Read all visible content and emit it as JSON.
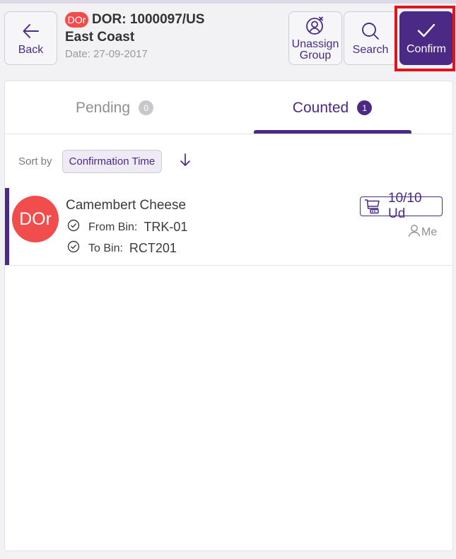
{
  "header": {
    "back_label": "Back",
    "doc_badge": "DOr",
    "doc_number": "DOR: 1000097/US",
    "doc_location": "East Coast",
    "doc_date": "Date: 27-09-2017",
    "unassign_label_1": "Unassign",
    "unassign_label_2": "Group",
    "search_label": "Search",
    "confirm_label": "Confirm"
  },
  "tabs": [
    {
      "label": "Pending",
      "count": "0",
      "active": false
    },
    {
      "label": "Counted",
      "count": "1",
      "active": true
    }
  ],
  "sort": {
    "label": "Sort by",
    "value": "Confirmation Time",
    "direction": "descending"
  },
  "items": [
    {
      "avatar": "DOr",
      "name": "Camembert Cheese",
      "from_label": "From Bin:",
      "from_value": "TRK-01",
      "to_label": "To Bin:",
      "to_value": "RCT201",
      "quantity": "10/10 Ud",
      "assignee": "Me"
    }
  ],
  "colors": {
    "accent": "#4b2a86",
    "avatar": "#f24d4d",
    "highlight": "#e0141c"
  }
}
